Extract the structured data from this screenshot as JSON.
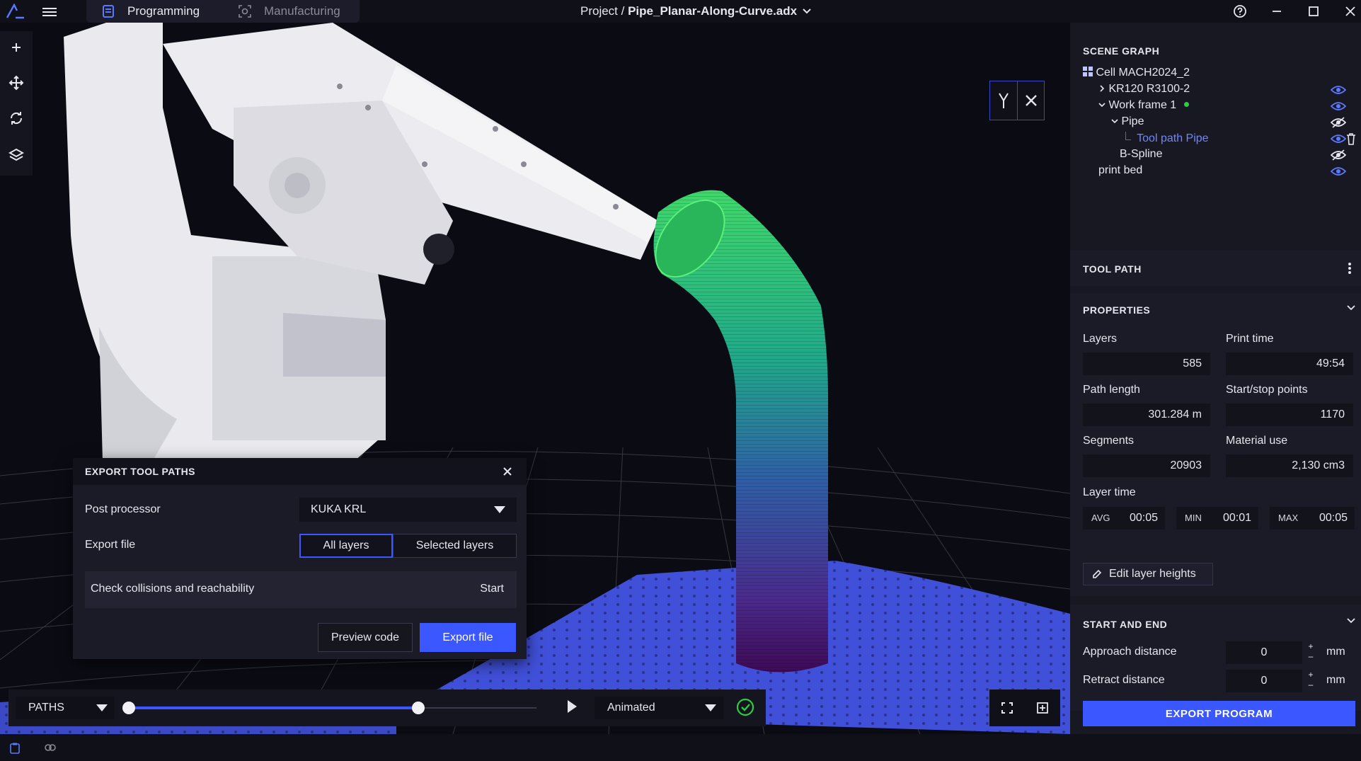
{
  "topbar": {
    "tabs": [
      {
        "label": "Programming",
        "icon": "document-icon",
        "active": true
      },
      {
        "label": "Manufacturing",
        "icon": "camera-scan-icon",
        "active": false
      }
    ],
    "project_prefix": "Project /",
    "project_name": "Pipe_Planar-Along-Curve.adx"
  },
  "left_toolbar": [
    "add-icon",
    "move-icon",
    "rotate-icon",
    "layers-icon"
  ],
  "scene_graph": {
    "title": "SCENE GRAPH",
    "items": [
      {
        "label": "Cell MACH2024_2",
        "icon": "grid-icon"
      },
      {
        "label": "KR120 R3100-2",
        "visible": true
      },
      {
        "label": "Work frame 1",
        "visible": true,
        "status_color": "#2ecc40"
      },
      {
        "label": "Pipe",
        "visible": false
      },
      {
        "label": "Tool path Pipe",
        "visible": true,
        "selected": true
      },
      {
        "label": "B-Spline",
        "visible": false
      },
      {
        "label": "print bed",
        "visible": true
      }
    ]
  },
  "tool_path": {
    "title": "TOOL PATH",
    "properties": {
      "title": "PROPERTIES",
      "layers_label": "Layers",
      "layers": "585",
      "print_time_label": "Print time",
      "print_time": "49:54",
      "path_length_label": "Path length",
      "path_length": "301.284 m",
      "start_stop_label": "Start/stop points",
      "start_stop": "1170",
      "segments_label": "Segments",
      "segments": "20903",
      "material_label": "Material use",
      "material": "2,130 cm3",
      "layer_time_label": "Layer time",
      "avg_label": "AVG",
      "avg": "00:05",
      "min_label": "MIN",
      "min": "00:01",
      "max_label": "MAX",
      "max": "00:05",
      "edit_button": "Edit layer heights"
    },
    "start_end": {
      "title": "START AND END",
      "approach_label": "Approach distance",
      "approach": "0",
      "retract_label": "Retract distance",
      "retract": "0",
      "unit": "mm"
    },
    "export_program": "EXPORT PROGRAM"
  },
  "export_dialog": {
    "title": "EXPORT TOOL PATHS",
    "post_processor_label": "Post processor",
    "post_processor_value": "KUKA KRL",
    "export_file_label": "Export file",
    "seg_all": "All layers",
    "seg_selected": "Selected layers",
    "collision_label": "Check collisions and reachability",
    "collision_action": "Start",
    "preview_button": "Preview code",
    "export_button": "Export file"
  },
  "timeline": {
    "paths_label": "PATHS",
    "range_start": 0.0,
    "range_end": 0.71,
    "mode_label": "Animated",
    "status_icon": "check-circle-icon"
  },
  "colors": {
    "accent": "#3b57ff",
    "ok": "#2ecc40",
    "selected_text": "#6f86ff"
  }
}
